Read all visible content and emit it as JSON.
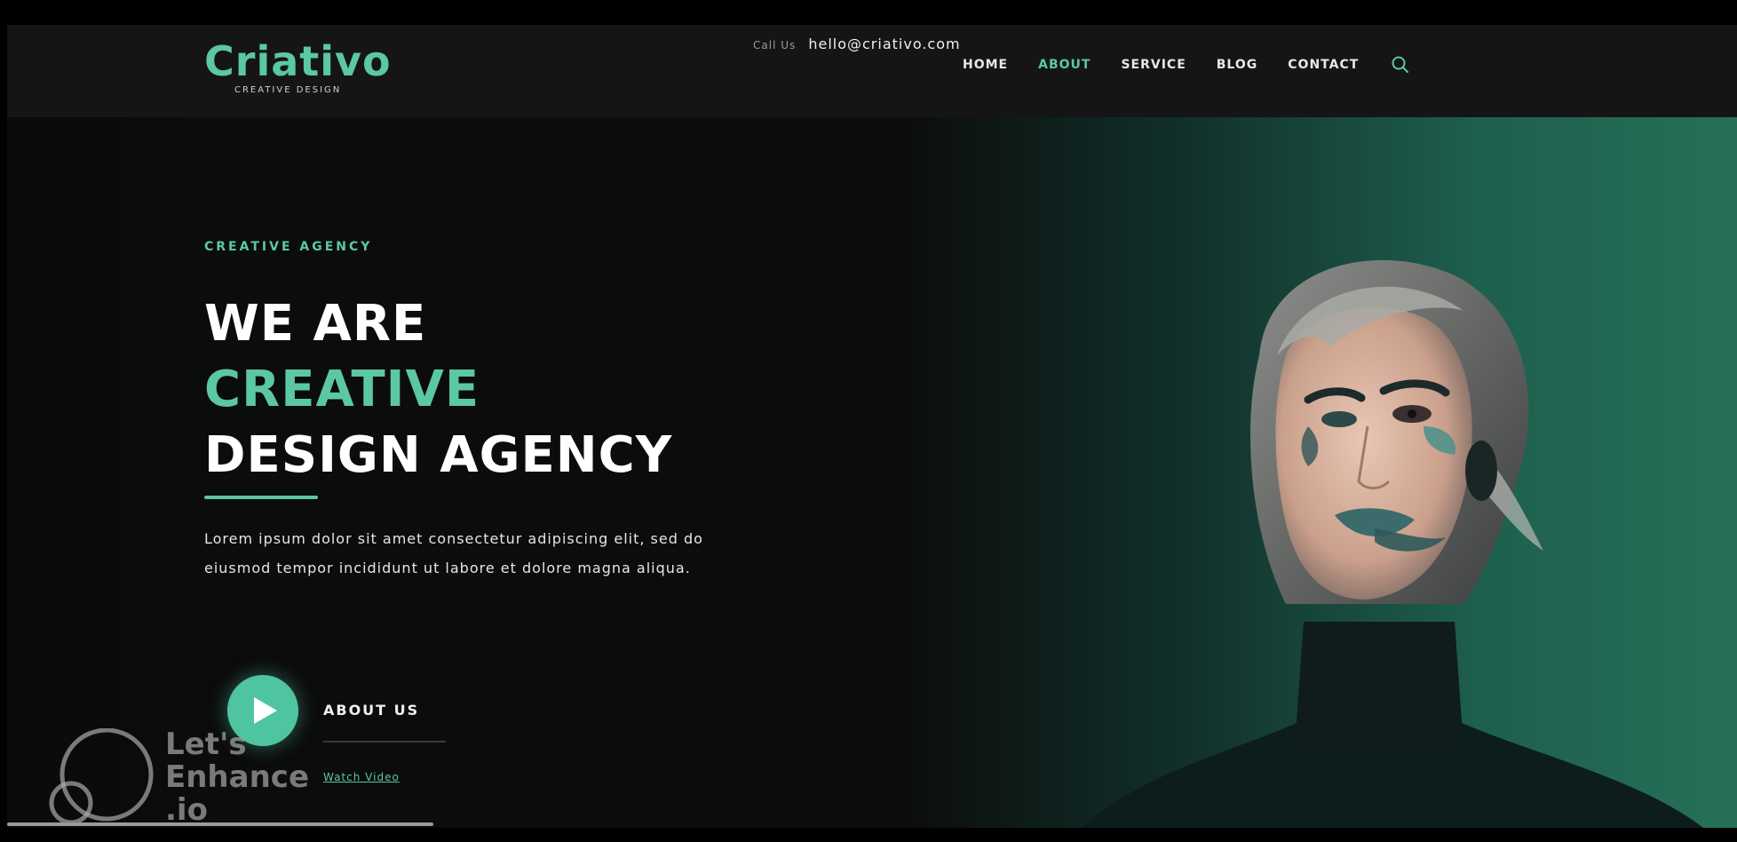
{
  "header": {
    "logo": "Criativo",
    "tagline": "CREATIVE DESIGN",
    "topline_muted": "Call Us",
    "topline": "hello@criativo.com",
    "nav": [
      {
        "label": "HOME",
        "active": false
      },
      {
        "label": "ABOUT",
        "active": true
      },
      {
        "label": "SERVICE",
        "active": false
      },
      {
        "label": "BLOG",
        "active": false
      },
      {
        "label": "CONTACT",
        "active": false
      }
    ],
    "search_icon": "search-icon"
  },
  "hero": {
    "eyebrow": "CREATIVE AGENCY",
    "headline_line1": "WE ARE",
    "headline_line2": "CREATIVE",
    "headline_line3": "DESIGN AGENCY",
    "paragraph": "Lorem ipsum dolor sit amet consectetur adipiscing elit, sed do eiusmod tempor incididunt ut labore et dolore magna aliqua.",
    "play_label": "ABOUT US",
    "play_link": "Watch Video",
    "play_icon": "play-icon"
  },
  "watermark": {
    "line1": "Let's",
    "line2": "Enhance",
    "line3": ".io"
  },
  "colors": {
    "accent": "#5cc7a4",
    "background": "#0b0b0b",
    "green_panel": "#267058"
  }
}
